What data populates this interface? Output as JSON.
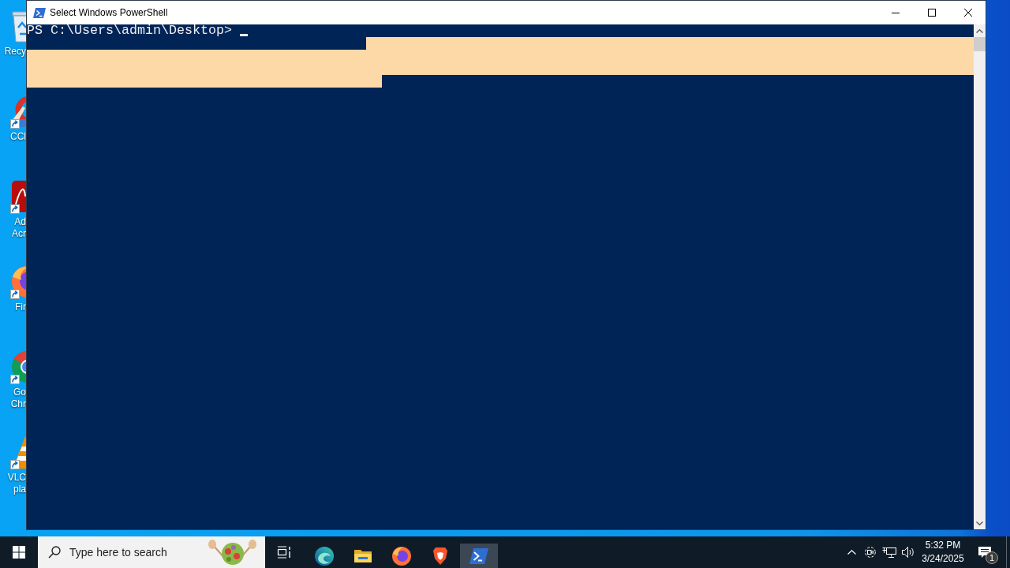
{
  "desktop": {
    "icons": [
      {
        "kind": "bin",
        "label_lines": [
          "Recy"
        ],
        "shortcut": false
      },
      {
        "kind": "cleaner",
        "label_lines": [
          "CCl"
        ],
        "shortcut": true
      },
      {
        "kind": "reader",
        "label_lines": [
          "Ad",
          "Acr"
        ],
        "shortcut": true
      },
      {
        "kind": "fox",
        "label_lines": [
          "Fir"
        ],
        "shortcut": true
      },
      {
        "kind": "ring",
        "label_lines": [
          "Go",
          "Chr"
        ],
        "shortcut": true
      },
      {
        "kind": "cone",
        "label_lines": [
          "VLC",
          "pla"
        ],
        "shortcut": true
      }
    ]
  },
  "window": {
    "title": "Select Windows PowerShell",
    "console": {
      "prompt": "PS C:\\Users\\admin\\Desktop>",
      "cursor": true,
      "selection_rows": [
        {
          "kind": "tail",
          "level": 0.642
        },
        {
          "kind": "full",
          "level": 1
        },
        {
          "kind": "full",
          "level": 1
        },
        {
          "kind": "head",
          "level": 0.375
        }
      ]
    }
  },
  "taskbar": {
    "search": {
      "placeholder": "Type here to search"
    },
    "apps": [
      {
        "kind": "swirl",
        "selected": false
      },
      {
        "kind": "folder",
        "selected": false
      },
      {
        "kind": "fox",
        "selected": false
      },
      {
        "kind": "shield",
        "selected": false
      },
      {
        "kind": "terminal",
        "selected": true
      }
    ],
    "tray": {
      "time": "5:32 PM",
      "date": "3/24/2025",
      "notification_count": "1"
    }
  }
}
